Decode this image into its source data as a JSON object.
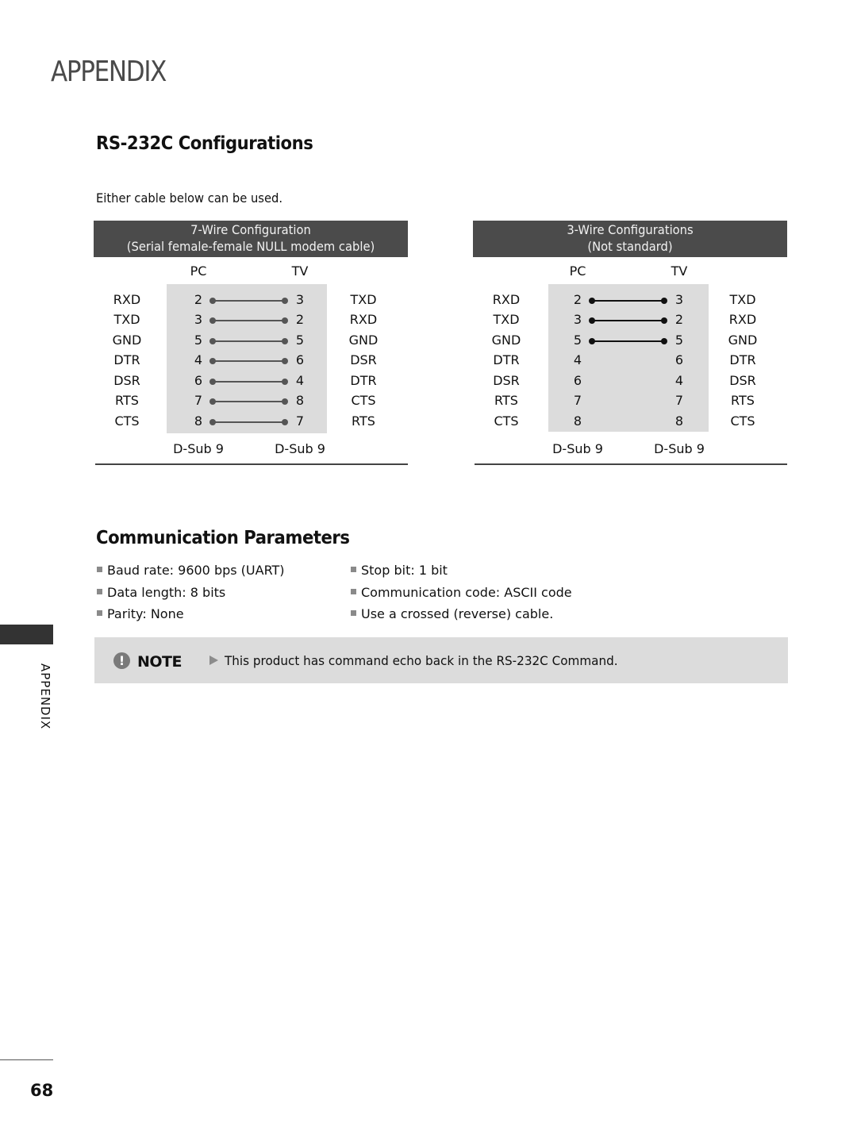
{
  "page": {
    "title": "APPENDIX",
    "side_tab_label": "APPENDIX",
    "page_number": "68"
  },
  "rs232": {
    "title": "RS-232C Configurations",
    "intro": "Either cable below can be used.",
    "diagrams": [
      {
        "header_line1": "7-Wire Configuration",
        "header_line2": "(Serial female-female NULL modem cable)",
        "pc_label": "PC",
        "tv_label": "TV",
        "connector_left": "D-Sub 9",
        "connector_right": "D-Sub 9",
        "wire_color": "#555555",
        "rows": [
          {
            "pc_signal": "RXD",
            "pc_pin": "2",
            "tv_pin": "3",
            "tv_signal": "TXD",
            "connected": true
          },
          {
            "pc_signal": "TXD",
            "pc_pin": "3",
            "tv_pin": "2",
            "tv_signal": "RXD",
            "connected": true
          },
          {
            "pc_signal": "GND",
            "pc_pin": "5",
            "tv_pin": "5",
            "tv_signal": "GND",
            "connected": true
          },
          {
            "pc_signal": "DTR",
            "pc_pin": "4",
            "tv_pin": "6",
            "tv_signal": "DSR",
            "connected": true
          },
          {
            "pc_signal": "DSR",
            "pc_pin": "6",
            "tv_pin": "4",
            "tv_signal": "DTR",
            "connected": true
          },
          {
            "pc_signal": "RTS",
            "pc_pin": "7",
            "tv_pin": "8",
            "tv_signal": "CTS",
            "connected": true
          },
          {
            "pc_signal": "CTS",
            "pc_pin": "8",
            "tv_pin": "7",
            "tv_signal": "RTS",
            "connected": true
          }
        ]
      },
      {
        "header_line1": "3-Wire Configurations",
        "header_line2": "(Not standard)",
        "pc_label": "PC",
        "tv_label": "TV",
        "connector_left": "D-Sub 9",
        "connector_right": "D-Sub 9",
        "wire_color": "#111111",
        "rows": [
          {
            "pc_signal": "RXD",
            "pc_pin": "2",
            "tv_pin": "3",
            "tv_signal": "TXD",
            "connected": true
          },
          {
            "pc_signal": "TXD",
            "pc_pin": "3",
            "tv_pin": "2",
            "tv_signal": "RXD",
            "connected": true
          },
          {
            "pc_signal": "GND",
            "pc_pin": "5",
            "tv_pin": "5",
            "tv_signal": "GND",
            "connected": true
          },
          {
            "pc_signal": "DTR",
            "pc_pin": "4",
            "tv_pin": "6",
            "tv_signal": "DTR",
            "connected": false
          },
          {
            "pc_signal": "DSR",
            "pc_pin": "6",
            "tv_pin": "4",
            "tv_signal": "DSR",
            "connected": false
          },
          {
            "pc_signal": "RTS",
            "pc_pin": "7",
            "tv_pin": "7",
            "tv_signal": "RTS",
            "connected": false
          },
          {
            "pc_signal": "CTS",
            "pc_pin": "8",
            "tv_pin": "8",
            "tv_signal": "CTS",
            "connected": false
          }
        ]
      }
    ]
  },
  "comm": {
    "title": "Communication Parameters",
    "left": [
      "Baud rate: 9600 bps (UART)",
      "Data length: 8 bits",
      "Parity: None"
    ],
    "right": [
      "Stop bit: 1 bit",
      "Communication code: ASCII code",
      "Use a crossed (reverse) cable."
    ]
  },
  "note": {
    "icon": "exclamation-icon",
    "label": "NOTE",
    "arrow_icon": "triangle-right-icon",
    "text": "This product has command echo back in the RS-232C Command."
  }
}
